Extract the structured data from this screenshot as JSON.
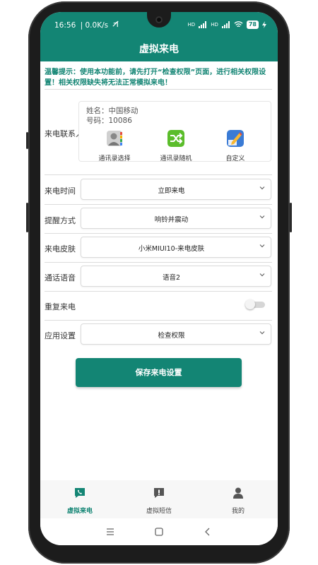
{
  "status_bar": {
    "time": "16:56",
    "speed": "0.0K/s",
    "signal1": "HD",
    "signal2": "HD",
    "battery": "78"
  },
  "app": {
    "title": "虚拟来电",
    "accent_color": "#138574"
  },
  "tip": "温馨提示：使用本功能前，请先打开“检查权限”页面，进行相关权限设置！相关权限缺失将无法正常模拟来电！",
  "contact": {
    "label": "来电联系人",
    "name_line": "姓名：中国移动",
    "number_line": "号码：10086",
    "actions": [
      {
        "label": "通讯录选择",
        "icon": "contact-book-icon"
      },
      {
        "label": "通讯录随机",
        "icon": "shuffle-icon"
      },
      {
        "label": "自定义",
        "icon": "pen-edit-icon"
      }
    ]
  },
  "settings": {
    "call_time": {
      "label": "来电时间",
      "value": "立即来电"
    },
    "remind_mode": {
      "label": "提醒方式",
      "value": "响铃并震动"
    },
    "skin": {
      "label": "来电皮肤",
      "value": "小米MIUI10-来电皮肤"
    },
    "voice": {
      "label": "通话语音",
      "value": "语音2"
    },
    "repeat": {
      "label": "重复来电",
      "enabled": false
    },
    "app_settings": {
      "label": "应用设置",
      "value": "检查权限"
    }
  },
  "save_button": "保存来电设置",
  "tabs": [
    {
      "label": "虚拟来电",
      "icon": "phone-chat-icon",
      "active": true
    },
    {
      "label": "虚拟短信",
      "icon": "message-icon",
      "active": false
    },
    {
      "label": "我的",
      "icon": "person-icon",
      "active": false
    }
  ]
}
